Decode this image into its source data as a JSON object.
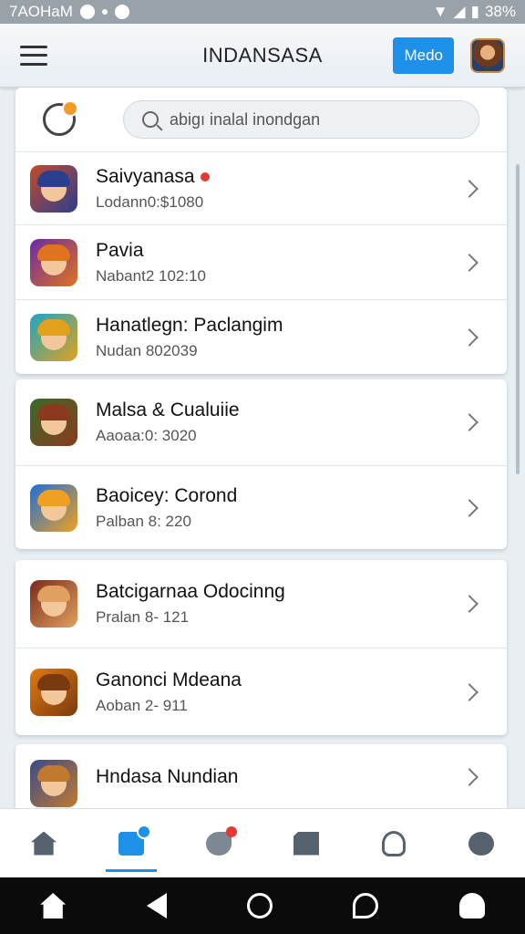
{
  "status": {
    "carrier": "7AOHaM",
    "battery": "38%"
  },
  "appbar": {
    "title": "INDANSASA",
    "mode_label": "Medo"
  },
  "search": {
    "placeholder": "abigı inalal inondgan"
  },
  "apps": [
    {
      "title": "Saivyanasa",
      "subtitle": "Lodann0:$1080",
      "badge": true,
      "colors": [
        "#c44a2a",
        "#2b3f8f"
      ]
    },
    {
      "title": "Pavia",
      "subtitle": "Nabant2 102:10",
      "badge": false,
      "colors": [
        "#6a2aa8",
        "#e0731d"
      ]
    },
    {
      "title": "Hanatlegn: Paclangim",
      "subtitle": "Nudan 802039",
      "badge": false,
      "colors": [
        "#1da5c4",
        "#e0a11d"
      ]
    },
    {
      "title": "Malsa & Cualuiie",
      "subtitle": "Aaoaa:0: 3020",
      "badge": false,
      "colors": [
        "#3a6b2a",
        "#8a3a1d"
      ]
    },
    {
      "title": "Baoicey: Corond",
      "subtitle": "Palban 8: 220",
      "badge": false,
      "colors": [
        "#1e6fd8",
        "#f0a020"
      ]
    },
    {
      "title": "Batcigarnaa Odocinng",
      "subtitle": "Pralan 8- 121",
      "badge": false,
      "colors": [
        "#7a2a1a",
        "#e0a060"
      ]
    },
    {
      "title": "Ganonci Mdeana",
      "subtitle": "Aoban 2- 911",
      "badge": false,
      "colors": [
        "#e07a10",
        "#7a3a10"
      ]
    },
    {
      "title": "Hndasa Nundian",
      "subtitle": "",
      "badge": false,
      "colors": [
        "#3a4a8a",
        "#c07a30"
      ]
    }
  ],
  "bottom_nav": [
    {
      "icon": "home-icon",
      "active": false
    },
    {
      "icon": "store-icon",
      "active": true
    },
    {
      "icon": "bird-icon",
      "active": false
    },
    {
      "icon": "puzzle-icon",
      "active": false
    },
    {
      "icon": "profile-icon",
      "active": false
    },
    {
      "icon": "compass-icon",
      "active": false
    }
  ],
  "accent": "#1e90e8"
}
